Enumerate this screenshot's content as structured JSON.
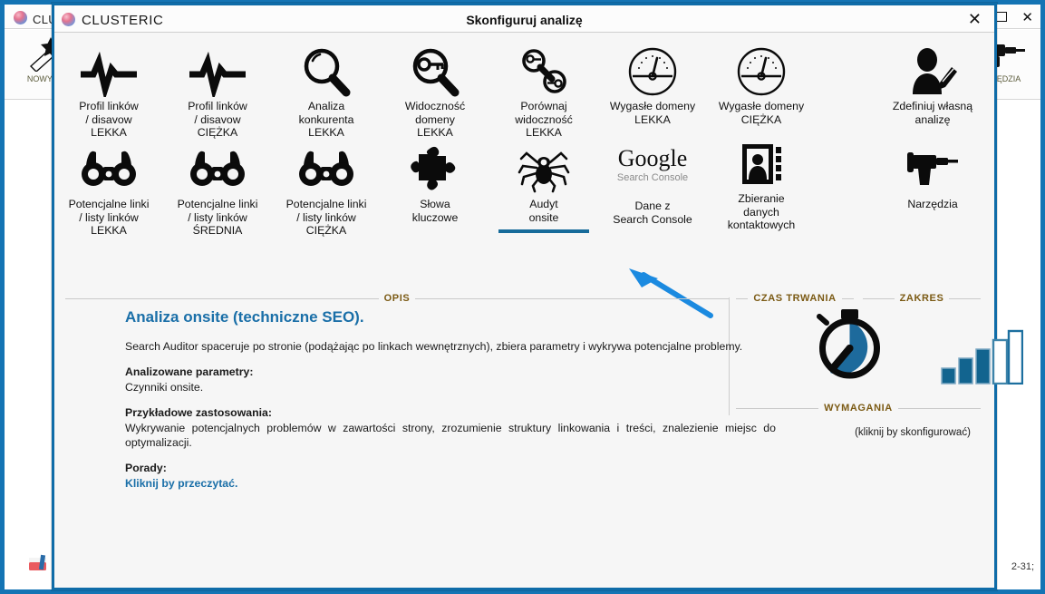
{
  "background_window": {
    "title": "CLUSTERIC",
    "window_buttons": {
      "restore": "restore-glyph",
      "close": "✕"
    },
    "left_tool_label": "NOWY P",
    "right_tool_label": "RZĘDZIA",
    "bottom_right_text": "2-31;"
  },
  "dialog": {
    "brand": "CLUSTERIC",
    "title": "Skonfiguruj analizę",
    "close_label": "✕",
    "analyses": [
      {
        "label": "Profil linków\n/ disavow\nLEKKA",
        "icon": "pulse-icon",
        "selected": false
      },
      {
        "label": "Profil linków\n/ disavow\nCIĘŻKA",
        "icon": "pulse-icon",
        "selected": false
      },
      {
        "label": "Analiza\nkonkurenta\nLEKKA",
        "icon": "magnifier-icon",
        "selected": false
      },
      {
        "label": "Widoczność\ndomeny\nLEKKA",
        "icon": "key-search-icon",
        "selected": false
      },
      {
        "label": "Porównaj\nwidoczność\nLEKKA",
        "icon": "compare-icon",
        "selected": false
      },
      {
        "label": "Wygasłe domeny\nLEKKA",
        "icon": "gauge-icon",
        "selected": false
      },
      {
        "label": "Wygasłe domeny\nCIĘŻKA",
        "icon": "gauge-icon",
        "selected": false
      },
      {
        "label": "Zdefiniuj własną\nanalizę",
        "icon": "user-edit-icon",
        "selected": false
      },
      {
        "label": "Potencjalne linki\n/ listy linków\nLEKKA",
        "icon": "binoculars-icon",
        "selected": false
      },
      {
        "label": "Potencjalne linki\n/ listy linków\nŚREDNIA",
        "icon": "binoculars-icon",
        "selected": false
      },
      {
        "label": "Potencjalne linki\n/ listy linków\nCIĘŻKA",
        "icon": "binoculars-icon",
        "selected": false
      },
      {
        "label": "Słowa\nkluczowe",
        "icon": "puzzle-icon",
        "selected": false
      },
      {
        "label": "Audyt\nonsite",
        "icon": "spider-icon",
        "selected": true
      },
      {
        "label": "Dane z\nSearch Console",
        "icon": "google-search-console-icon",
        "selected": false
      },
      {
        "label": "Zbieranie\ndanych\nkontaktowych",
        "icon": "address-book-icon",
        "selected": false
      },
      {
        "label": "Narzędzia",
        "icon": "drill-icon",
        "selected": false
      }
    ],
    "google_logo": {
      "word": "Google",
      "sub": "Search Console"
    },
    "sections": {
      "opis": "OPIS",
      "czas_trwania": "CZAS TRWANIA",
      "zakres": "ZAKRES",
      "wymagania": "WYMAGANIA"
    },
    "description": {
      "heading": "Analiza onsite (techniczne SEO).",
      "intro": "Search Auditor spaceruje po stronie (podążając po linkach wewnętrznych), zbiera parametry i wykrywa potencjalne problemy.",
      "params_label": "Analizowane parametry:",
      "params_value": "Czynniki onsite.",
      "usecases_label": "Przykładowe zastosowania:",
      "usecases_value": "Wykrywanie potencjalnych problemów w zawartości strony, zrozumienie struktury linkowania i treści, znalezienie miejsc do optymalizacji.",
      "tips_label": "Porady:",
      "tips_link": "Kliknij by przeczytać."
    },
    "requirements_hint": "(kliknij by skonfigurować)",
    "duration": {
      "icon": "stopwatch-icon",
      "fill_fraction": 0.62
    },
    "scope": {
      "icon": "bar-chart-icon",
      "bars_total": 5,
      "bars_filled": 3,
      "heights": [
        18,
        30,
        39,
        48,
        57
      ]
    }
  },
  "colors": {
    "accent_blue": "#1474b4",
    "dialog_border": "#0f6ca8",
    "underline": "#176b9a",
    "arrow": "#1b8ae0",
    "heading_blue": "#1a6fa8",
    "section_label": "#7b5a14",
    "panel_bg": "#f6f6f6"
  }
}
